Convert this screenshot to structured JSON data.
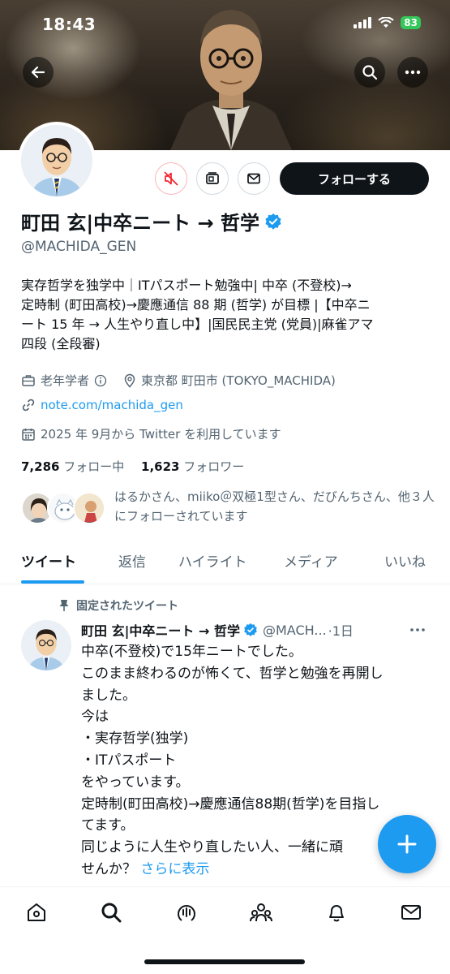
{
  "status_bar": {
    "time": "18:43",
    "battery": "83"
  },
  "header": {
    "back_icon": "arrow-left-icon",
    "search_icon": "search-icon",
    "more_icon": "more-horizontal-icon"
  },
  "profile": {
    "display_name": "町田 玄|中卒ニート → 哲学",
    "verified": true,
    "handle": "@MACHIDA_GEN",
    "bio": [
      "実存哲学を独学中｜ITパスポート勉強中| 中卒 (不登校)→",
      "定時制 (町田高校)→慶應通信 88 期 (哲学) が目標 |【中卒ニ",
      "ート 15 年 → 人生やり直し中】|国民民主党 (党員)|麻雀アマ",
      "四段 (全段審)"
    ],
    "category": "老年学者",
    "location": "東京都 町田市 (TOKYO_MACHIDA)",
    "website": "note.com/machida_gen",
    "joined": "2025 年 9月から Twitter を利用しています",
    "following_count": "7,286",
    "following_label": "フォロー中",
    "followers_count": "1,623",
    "followers_label": "フォロワー",
    "followed_by_text": "はるかさん、miiko＠双極1型さん、だびんちさん、他３人にフォローされています"
  },
  "actions": {
    "mute_icon": "speaker-muted-icon",
    "subscribe_icon": "newsletter-icon",
    "message_icon": "mail-icon",
    "follow_label": "フォローする"
  },
  "tabs": [
    {
      "label": "ツイート",
      "active": true
    },
    {
      "label": "返信",
      "active": false
    },
    {
      "label": "ハイライト",
      "active": false
    },
    {
      "label": "メディア",
      "active": false
    },
    {
      "label": "いいね",
      "active": false
    }
  ],
  "tweet": {
    "pinned_label": "固定されたツイート",
    "author_name": "町田 玄|中卒ニート → 哲学",
    "author_handle": "@MACH...",
    "time": "·1日",
    "lines": [
      "中卒(不登校)で15年ニートでした。",
      "このまま終わるのが怖くて、哲学と勉強を再開し",
      "ました。",
      "今は",
      "・実存哲学(独学)",
      "・ITパスポート",
      "をやっています。",
      "定時制(町田高校)→慶應通信88期(哲学)を目指し",
      "てます。",
      "同じように人生やり直したい人、一緒に頑",
      "せんか？"
    ],
    "show_more": "さらに表示"
  },
  "fab_icon": "plus-icon",
  "bottom_nav": [
    "home-icon",
    "search-icon",
    "spaces-icon",
    "communities-icon",
    "notifications-icon",
    "messages-icon"
  ],
  "colors": {
    "accent": "#1d9bf0",
    "text": "#0f1419",
    "muted": "#536471",
    "mute_red": "#f4212e"
  }
}
